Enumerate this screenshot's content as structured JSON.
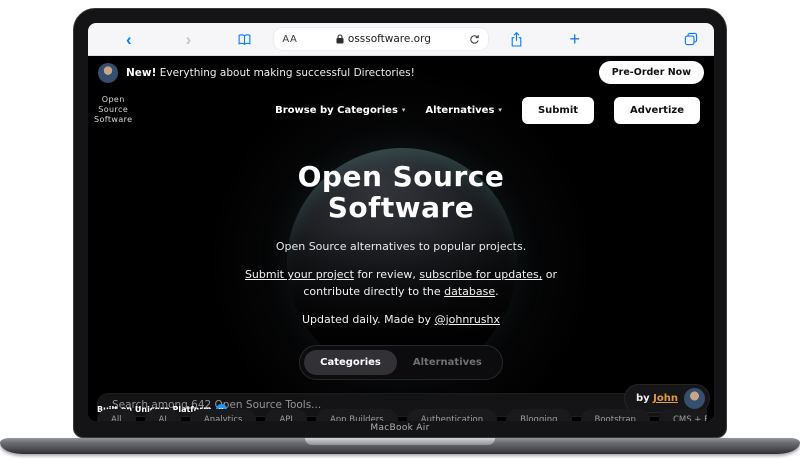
{
  "device": {
    "name": "MacBook Air"
  },
  "colors": {
    "safari_accent": "#0a7aff",
    "site_bg": "#000000",
    "link_orange": "#e09c3c",
    "unicorn_blue": "#1e9bf0",
    "button_bg": "#ffffff"
  },
  "icons": {
    "back": "‹",
    "forward": "›",
    "new_tab": "+",
    "caret_down": "▾",
    "unicorn_letter": "u"
  },
  "browser": {
    "reader_label": "AA",
    "url": "osssoftware.org"
  },
  "banner": {
    "highlight": "New!",
    "text": "Everything about making successful Directories!",
    "cta_label": "Pre-Order Now"
  },
  "nav": {
    "logo_lines": [
      "Open",
      "Source",
      "Software"
    ],
    "menu": [
      {
        "label": "Browse by Categories"
      },
      {
        "label": "Alternatives"
      }
    ],
    "submit_label": "Submit",
    "advertise_label": "Advertize"
  },
  "hero": {
    "title_line1": "Open Source",
    "title_line2": "Software",
    "subtitle": "Open Source alternatives to popular projects.",
    "links": {
      "link1": "Submit your project",
      "mid1": " for review, ",
      "link2": "subscribe for updates,",
      "mid2": " or contribute directly to the ",
      "link3": "database",
      "end": "."
    },
    "updated_prefix": "Updated daily. Made by ",
    "updated_link": "@johnrushx"
  },
  "tabs": {
    "items": [
      "Categories",
      "Alternatives"
    ],
    "active": "Categories"
  },
  "search": {
    "placeholder": "Search among 642 Open Source Tools...",
    "tool_count": "642"
  },
  "byline": {
    "prefix": "by",
    "name": "John"
  },
  "footer": {
    "built_prefix": "Built on",
    "platform": "Unicorn Platform"
  },
  "chips": [
    "All",
    "AI",
    "Analytics",
    "API",
    "App Builders",
    "Authentication",
    "Blogging",
    "Bootstrap",
    "CMS + Blogs"
  ]
}
